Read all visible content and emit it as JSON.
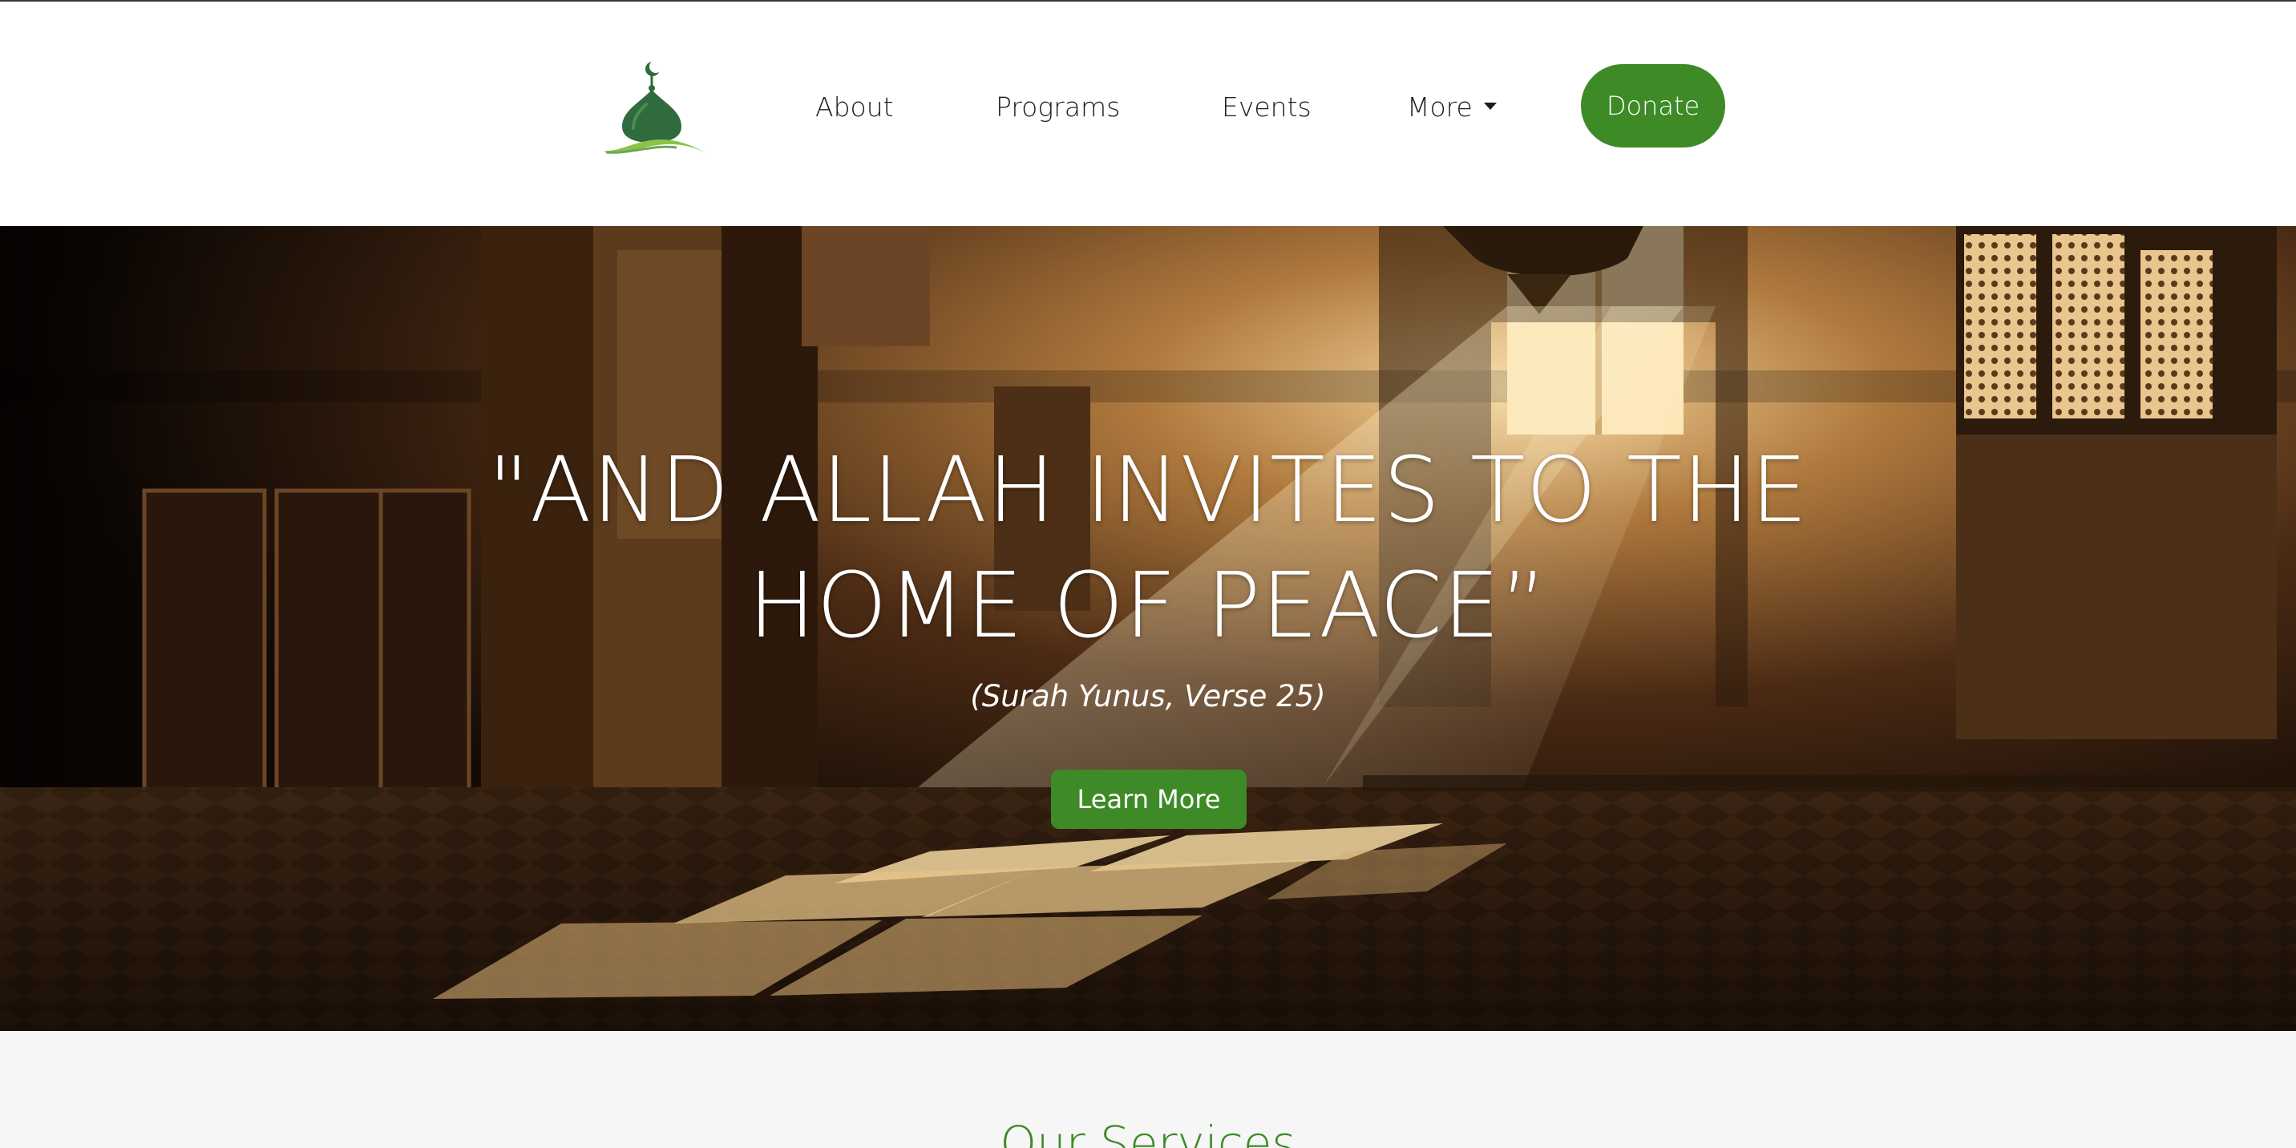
{
  "nav": {
    "logo_alt": "Mosque dome logo",
    "items": [
      {
        "label": "About"
      },
      {
        "label": "Programs"
      },
      {
        "label": "Events"
      },
      {
        "label": "More"
      }
    ],
    "donate_label": "Donate"
  },
  "hero": {
    "title_line1": "\"AND ALLAH INVITES TO THE",
    "title_line2": "HOME OF PEACE”",
    "subtitle": "(Surah Yunus, Verse 25)",
    "cta_label": "Learn More"
  },
  "services": {
    "title": "Our Services"
  },
  "colors": {
    "brand_green": "#3d8a26",
    "nav_text": "#1e1e1e",
    "section_bg": "#f6f6f6"
  },
  "icons": {
    "logo": "mosque-dome-icon",
    "more_caret": "caret-down-icon"
  }
}
